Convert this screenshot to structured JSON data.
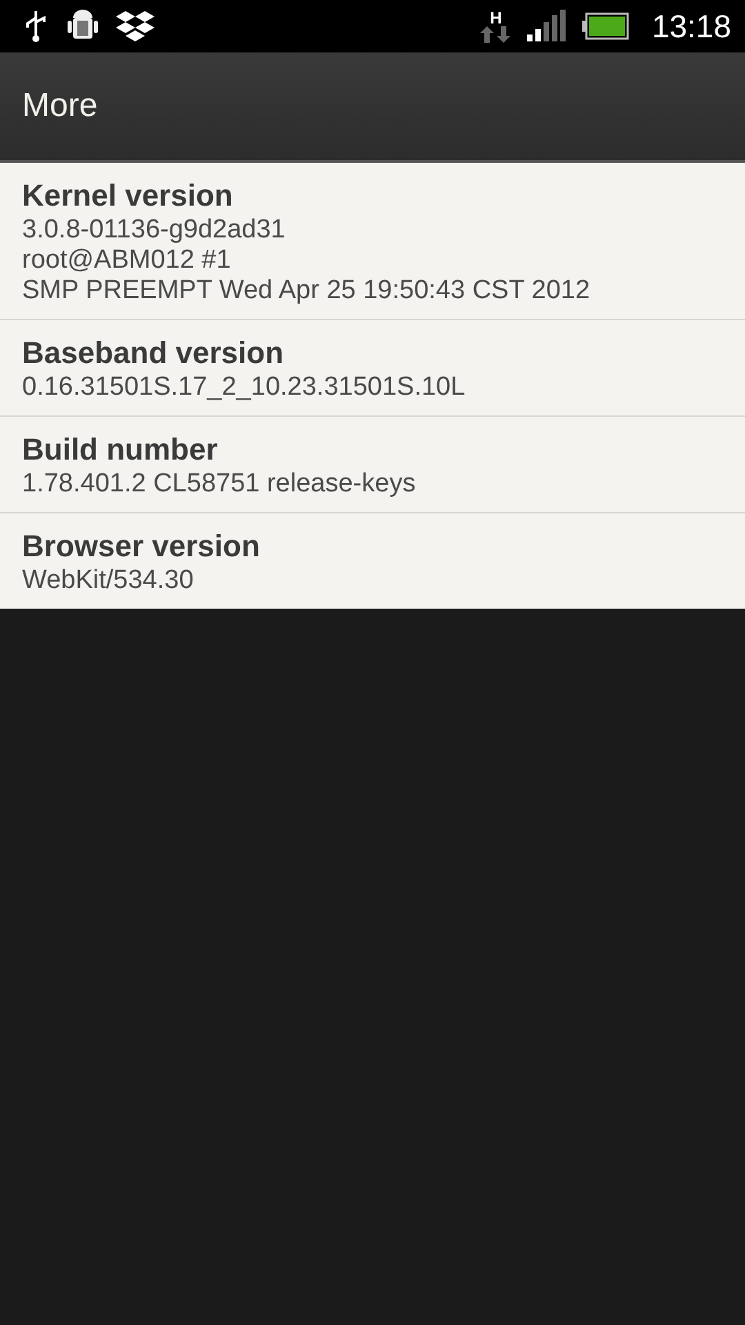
{
  "status_bar": {
    "network_type": "H",
    "time": "13:18"
  },
  "header": {
    "title": "More"
  },
  "items": [
    {
      "title": "Kernel version",
      "lines": [
        "3.0.8-01136-g9d2ad31",
        "root@ABM012 #1",
        "SMP PREEMPT Wed Apr 25 19:50:43 CST 2012"
      ]
    },
    {
      "title": "Baseband version",
      "lines": [
        "0.16.31501S.17_2_10.23.31501S.10L"
      ]
    },
    {
      "title": "Build number",
      "lines": [
        "1.78.401.2 CL58751 release-keys"
      ]
    },
    {
      "title": "Browser version",
      "lines": [
        "WebKit/534.30"
      ]
    }
  ]
}
